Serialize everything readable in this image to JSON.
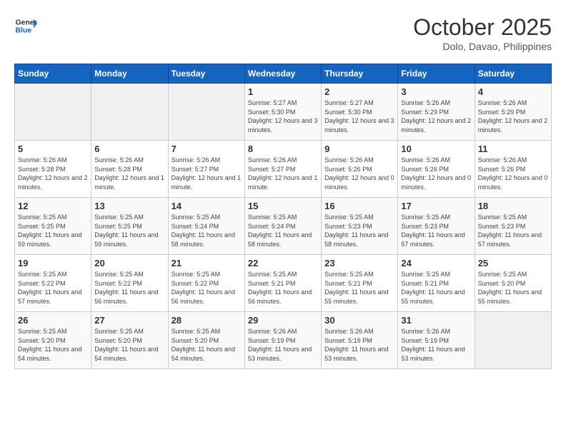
{
  "header": {
    "logo_line1": "General",
    "logo_line2": "Blue",
    "month": "October 2025",
    "location": "Dolo, Davao, Philippines"
  },
  "weekdays": [
    "Sunday",
    "Monday",
    "Tuesday",
    "Wednesday",
    "Thursday",
    "Friday",
    "Saturday"
  ],
  "weeks": [
    [
      {
        "day": "",
        "info": ""
      },
      {
        "day": "",
        "info": ""
      },
      {
        "day": "",
        "info": ""
      },
      {
        "day": "1",
        "info": "Sunrise: 5:27 AM\nSunset: 5:30 PM\nDaylight: 12 hours and 3 minutes."
      },
      {
        "day": "2",
        "info": "Sunrise: 5:27 AM\nSunset: 5:30 PM\nDaylight: 12 hours and 3 minutes."
      },
      {
        "day": "3",
        "info": "Sunrise: 5:26 AM\nSunset: 5:29 PM\nDaylight: 12 hours and 2 minutes."
      },
      {
        "day": "4",
        "info": "Sunrise: 5:26 AM\nSunset: 5:29 PM\nDaylight: 12 hours and 2 minutes."
      }
    ],
    [
      {
        "day": "5",
        "info": "Sunrise: 5:26 AM\nSunset: 5:28 PM\nDaylight: 12 hours and 2 minutes."
      },
      {
        "day": "6",
        "info": "Sunrise: 5:26 AM\nSunset: 5:28 PM\nDaylight: 12 hours and 1 minute."
      },
      {
        "day": "7",
        "info": "Sunrise: 5:26 AM\nSunset: 5:27 PM\nDaylight: 12 hours and 1 minute."
      },
      {
        "day": "8",
        "info": "Sunrise: 5:26 AM\nSunset: 5:27 PM\nDaylight: 12 hours and 1 minute."
      },
      {
        "day": "9",
        "info": "Sunrise: 5:26 AM\nSunset: 5:26 PM\nDaylight: 12 hours and 0 minutes."
      },
      {
        "day": "10",
        "info": "Sunrise: 5:26 AM\nSunset: 5:26 PM\nDaylight: 12 hours and 0 minutes."
      },
      {
        "day": "11",
        "info": "Sunrise: 5:26 AM\nSunset: 5:26 PM\nDaylight: 12 hours and 0 minutes."
      }
    ],
    [
      {
        "day": "12",
        "info": "Sunrise: 5:25 AM\nSunset: 5:25 PM\nDaylight: 11 hours and 59 minutes."
      },
      {
        "day": "13",
        "info": "Sunrise: 5:25 AM\nSunset: 5:25 PM\nDaylight: 11 hours and 59 minutes."
      },
      {
        "day": "14",
        "info": "Sunrise: 5:25 AM\nSunset: 5:24 PM\nDaylight: 11 hours and 58 minutes."
      },
      {
        "day": "15",
        "info": "Sunrise: 5:25 AM\nSunset: 5:24 PM\nDaylight: 11 hours and 58 minutes."
      },
      {
        "day": "16",
        "info": "Sunrise: 5:25 AM\nSunset: 5:23 PM\nDaylight: 11 hours and 58 minutes."
      },
      {
        "day": "17",
        "info": "Sunrise: 5:25 AM\nSunset: 5:23 PM\nDaylight: 11 hours and 57 minutes."
      },
      {
        "day": "18",
        "info": "Sunrise: 5:25 AM\nSunset: 5:23 PM\nDaylight: 11 hours and 57 minutes."
      }
    ],
    [
      {
        "day": "19",
        "info": "Sunrise: 5:25 AM\nSunset: 5:22 PM\nDaylight: 11 hours and 57 minutes."
      },
      {
        "day": "20",
        "info": "Sunrise: 5:25 AM\nSunset: 5:22 PM\nDaylight: 11 hours and 56 minutes."
      },
      {
        "day": "21",
        "info": "Sunrise: 5:25 AM\nSunset: 5:22 PM\nDaylight: 11 hours and 56 minutes."
      },
      {
        "day": "22",
        "info": "Sunrise: 5:25 AM\nSunset: 5:21 PM\nDaylight: 11 hours and 56 minutes."
      },
      {
        "day": "23",
        "info": "Sunrise: 5:25 AM\nSunset: 5:21 PM\nDaylight: 11 hours and 55 minutes."
      },
      {
        "day": "24",
        "info": "Sunrise: 5:25 AM\nSunset: 5:21 PM\nDaylight: 11 hours and 55 minutes."
      },
      {
        "day": "25",
        "info": "Sunrise: 5:25 AM\nSunset: 5:20 PM\nDaylight: 11 hours and 55 minutes."
      }
    ],
    [
      {
        "day": "26",
        "info": "Sunrise: 5:25 AM\nSunset: 5:20 PM\nDaylight: 11 hours and 54 minutes."
      },
      {
        "day": "27",
        "info": "Sunrise: 5:25 AM\nSunset: 5:20 PM\nDaylight: 11 hours and 54 minutes."
      },
      {
        "day": "28",
        "info": "Sunrise: 5:25 AM\nSunset: 5:20 PM\nDaylight: 11 hours and 54 minutes."
      },
      {
        "day": "29",
        "info": "Sunrise: 5:26 AM\nSunset: 5:19 PM\nDaylight: 11 hours and 53 minutes."
      },
      {
        "day": "30",
        "info": "Sunrise: 5:26 AM\nSunset: 5:19 PM\nDaylight: 11 hours and 53 minutes."
      },
      {
        "day": "31",
        "info": "Sunrise: 5:26 AM\nSunset: 5:19 PM\nDaylight: 11 hours and 53 minutes."
      },
      {
        "day": "",
        "info": ""
      }
    ]
  ]
}
